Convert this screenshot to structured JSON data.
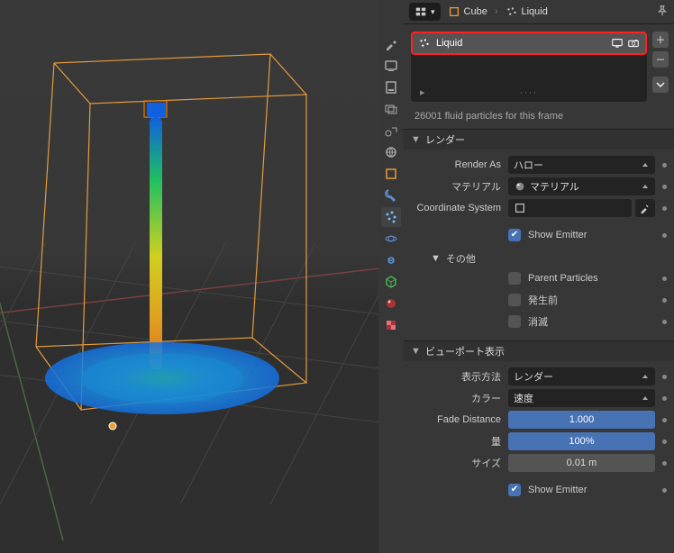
{
  "header": {
    "mode_label": "",
    "breadcrumb_object": "Cube",
    "breadcrumb_system": "Liquid"
  },
  "slot": {
    "name": "Liquid"
  },
  "info": {
    "particle_count": "26001 fluid particles for this frame"
  },
  "sections": {
    "render": {
      "title": "レンダー",
      "render_as_label": "Render As",
      "render_as_value": "ハロー",
      "material_label": "マテリアル",
      "material_value": "マテリアル",
      "coord_label": "Coordinate System",
      "coord_value": "",
      "show_emitter_label": "Show Emitter",
      "show_emitter": true,
      "extras_title": "その他",
      "parent_particles_label": "Parent Particles",
      "parent_particles": false,
      "unborn_label": "発生前",
      "unborn": false,
      "dead_label": "消滅",
      "dead": false
    },
    "viewport_display": {
      "title": "ビューポート表示",
      "display_method_label": "表示方法",
      "display_method_value": "レンダー",
      "color_label": "カラー",
      "color_value": "速度",
      "fade_distance_label": "Fade Distance",
      "fade_distance_value": "1.000",
      "amount_label": "量",
      "amount_value": "100%",
      "size_label": "サイズ",
      "size_value": "0.01 m",
      "show_emitter_label": "Show Emitter",
      "show_emitter": true
    }
  }
}
